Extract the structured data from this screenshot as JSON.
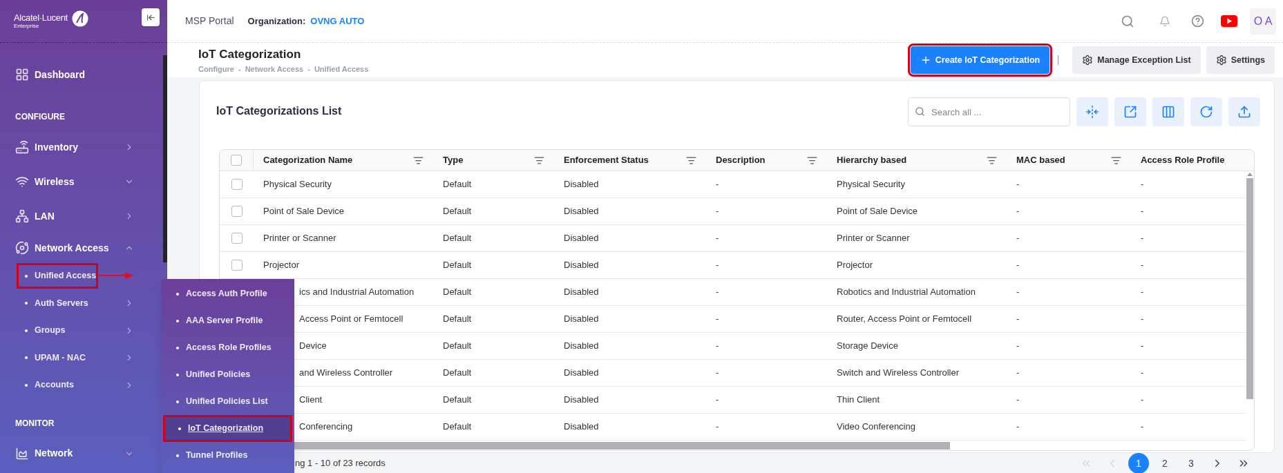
{
  "sidebar": {
    "logo": {
      "name": "Alcatel·Lucent",
      "tagline": "Enterprise"
    },
    "items": [
      {
        "kind": "link",
        "label": "Dashboard"
      },
      {
        "kind": "section",
        "label": "CONFIGURE"
      },
      {
        "kind": "link",
        "label": "Inventory",
        "flyout": true,
        "expanded": false
      },
      {
        "kind": "link",
        "label": "Wireless",
        "flyout": false,
        "expanded": false
      },
      {
        "kind": "link",
        "label": "LAN",
        "flyout": true,
        "expanded": false
      },
      {
        "kind": "link",
        "label": "Network Access",
        "expanded": true,
        "children": [
          {
            "label": "Unified Access",
            "highlighted": true
          },
          {
            "label": "Auth Servers",
            "flyout": true,
            "expanded": false,
            "highlighted": false
          },
          {
            "label": "Groups",
            "flyout": true,
            "expanded": false,
            "highlighted": false
          },
          {
            "label": "UPAM - NAC",
            "flyout": true,
            "expanded": false,
            "highlighted": false
          },
          {
            "label": "Accounts",
            "flyout": true,
            "expanded": false,
            "highlighted": false
          }
        ]
      },
      {
        "kind": "section",
        "label": "MONITOR"
      },
      {
        "kind": "link",
        "label": "Network",
        "flyout": false,
        "expanded": false
      }
    ]
  },
  "flyout": {
    "items": [
      {
        "label": "Access Auth Profile",
        "selected": false,
        "highlighted": false
      },
      {
        "label": "AAA Server Profile",
        "selected": false,
        "highlighted": false
      },
      {
        "label": "Access Role Profiles",
        "selected": false,
        "highlighted": false
      },
      {
        "label": "Unified Policies",
        "selected": false,
        "highlighted": false
      },
      {
        "label": "Unified Policies List",
        "selected": false,
        "highlighted": false
      },
      {
        "label": "IoT Categorization",
        "selected": true,
        "highlighted": true
      },
      {
        "label": "Tunnel Profiles",
        "selected": false,
        "highlighted": false
      }
    ]
  },
  "topbar": {
    "portal": "MSP Portal",
    "org_label": "Organization:",
    "org_name": "OVNG AUTO",
    "avatar": "O A"
  },
  "page": {
    "title": "IoT Categorization",
    "breadcrumb": [
      "Configure",
      "Network Access",
      "Unified Access"
    ],
    "breadcrumb_separator": "-",
    "actions": [
      {
        "kind": "primary",
        "label": "Create IoT Categorization",
        "highlighted": true
      },
      {
        "kind": "secondary",
        "label": "Manage Exception List",
        "highlighted": false
      },
      {
        "kind": "secondary",
        "label": "Settings",
        "highlighted": false
      }
    ]
  },
  "card": {
    "title": "IoT Categorizations List",
    "search": {
      "placeholder": "Search all ..."
    }
  },
  "table": {
    "select_all": {
      "checked": false
    },
    "columns": [
      {
        "label": "Categorization Name",
        "filter": true
      },
      {
        "label": "Type",
        "filter": true
      },
      {
        "label": "Enforcement Status",
        "filter": true
      },
      {
        "label": "Description",
        "filter": true
      },
      {
        "label": "Hierarchy based",
        "filter": true
      },
      {
        "label": "MAC based",
        "filter": true
      },
      {
        "label": "Access Role Profile",
        "filter": false
      }
    ],
    "rows": [
      {
        "checked": false,
        "cells": [
          "Physical Security",
          "Default",
          "Disabled",
          "-",
          "Physical Security",
          "-",
          "-"
        ]
      },
      {
        "checked": false,
        "cells": [
          "Point of Sale Device",
          "Default",
          "Disabled",
          "-",
          "Point of Sale Device",
          "-",
          "-"
        ]
      },
      {
        "checked": false,
        "cells": [
          "Printer or Scanner",
          "Default",
          "Disabled",
          "-",
          "Printer or Scanner",
          "-",
          "-"
        ]
      },
      {
        "checked": false,
        "cells": [
          "Projector",
          "Default",
          "Disabled",
          "-",
          "Projector",
          "-",
          "-"
        ]
      },
      {
        "cells": [
          "ics and Industrial Automation",
          "Default",
          "Disabled",
          "-",
          "Robotics and Industrial Automation",
          "-",
          "-"
        ]
      },
      {
        "cells": [
          "Access Point or Femtocell",
          "Default",
          "Disabled",
          "-",
          "Router, Access Point or Femtocell",
          "-",
          "-"
        ]
      },
      {
        "cells": [
          "Device",
          "Default",
          "Disabled",
          "-",
          "Storage Device",
          "-",
          "-"
        ]
      },
      {
        "cells": [
          "and Wireless Controller",
          "Default",
          "Disabled",
          "-",
          "Switch and Wireless Controller",
          "-",
          "-"
        ]
      },
      {
        "cells": [
          "Client",
          "Default",
          "Disabled",
          "-",
          "Thin Client",
          "-",
          "-"
        ]
      },
      {
        "cells": [
          "Conferencing",
          "Default",
          "Disabled",
          "-",
          "Video Conferencing",
          "-",
          "-"
        ]
      }
    ]
  },
  "footer": {
    "summary": "ng 1 - 10 of 23 records",
    "nav": [
      {
        "kind": "first",
        "disabled": true
      },
      {
        "kind": "prev",
        "disabled": true
      },
      {
        "kind": "next",
        "disabled": false
      },
      {
        "kind": "last",
        "disabled": false
      }
    ],
    "pages": [
      {
        "label": "1",
        "selected": true
      },
      {
        "label": "2",
        "selected": false
      },
      {
        "label": "3",
        "selected": false
      }
    ]
  }
}
